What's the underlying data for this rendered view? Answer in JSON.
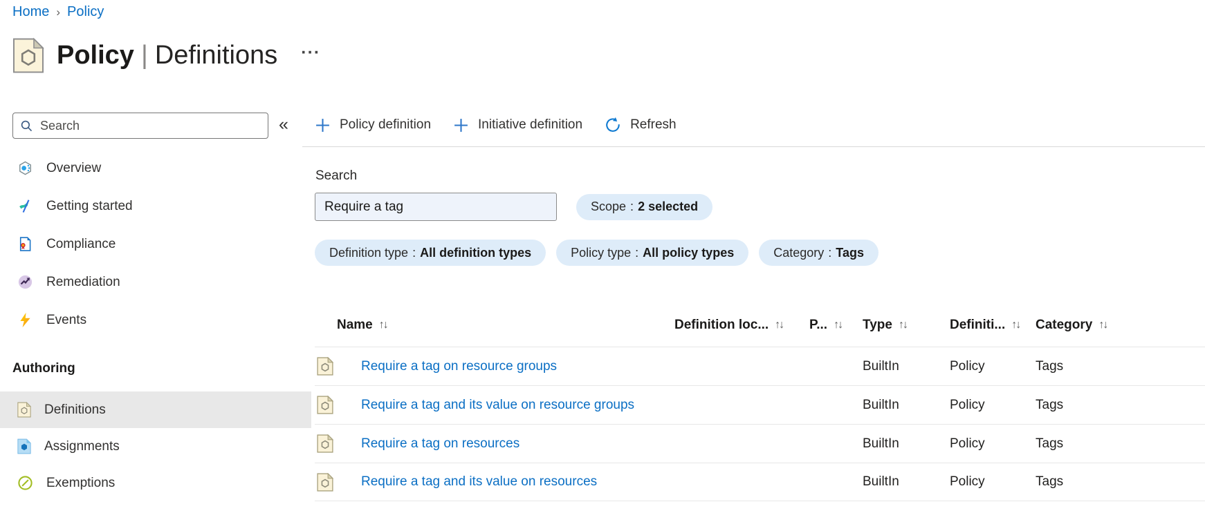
{
  "breadcrumb": {
    "items": [
      "Home",
      "Policy"
    ],
    "separator": "›"
  },
  "header": {
    "title": "Policy",
    "separator": "|",
    "subtitle": "Definitions",
    "more_glyph": "···"
  },
  "sidebar": {
    "search": {
      "placeholder": "Search"
    },
    "collapse_glyph": "«",
    "items": [
      {
        "label": "Overview"
      },
      {
        "label": "Getting started"
      },
      {
        "label": "Compliance"
      },
      {
        "label": "Remediation"
      },
      {
        "label": "Events"
      }
    ],
    "authoring": {
      "label": "Authoring",
      "items": [
        {
          "label": "Definitions",
          "selected": true
        },
        {
          "label": "Assignments",
          "selected": false
        },
        {
          "label": "Exemptions",
          "selected": false
        }
      ]
    }
  },
  "toolbar": {
    "items": [
      {
        "label": "Policy definition"
      },
      {
        "label": "Initiative definition"
      },
      {
        "label": "Refresh"
      }
    ]
  },
  "filters": {
    "search_label": "Search",
    "search_value": "Require a tag",
    "scope_pill": {
      "label": "Scope",
      "separator": ":",
      "value": "2 selected"
    },
    "pills": [
      {
        "label": "Definition type",
        "separator": ":",
        "value": "All definition types"
      },
      {
        "label": "Policy type",
        "separator": ":",
        "value": "All policy types"
      },
      {
        "label": "Category",
        "separator": ":",
        "value": "Tags"
      }
    ]
  },
  "table": {
    "sort_glyph": "↑↓",
    "columns": [
      {
        "label": "Name"
      },
      {
        "label": "Definition loc..."
      },
      {
        "label": "P..."
      },
      {
        "label": "Type"
      },
      {
        "label": "Definiti..."
      },
      {
        "label": "Category"
      }
    ],
    "rows": [
      {
        "name": "Require a tag on resource groups",
        "definition_location": "",
        "policies": "",
        "type": "BuiltIn",
        "definition_type": "Policy",
        "category": "Tags"
      },
      {
        "name": "Require a tag and its value on resource groups",
        "definition_location": "",
        "policies": "",
        "type": "BuiltIn",
        "definition_type": "Policy",
        "category": "Tags"
      },
      {
        "name": "Require a tag on resources",
        "definition_location": "",
        "policies": "",
        "type": "BuiltIn",
        "definition_type": "Policy",
        "category": "Tags"
      },
      {
        "name": "Require a tag and its value on resources",
        "definition_location": "",
        "policies": "",
        "type": "BuiltIn",
        "definition_type": "Policy",
        "category": "Tags"
      }
    ]
  },
  "colors": {
    "accent": "#0078d4",
    "link": "#0b6fc4",
    "pill_background": "#deecf9",
    "input_background": "#eef3fb",
    "selected_item_background": "#e8e8e8",
    "divider": "#d8d8d8"
  }
}
